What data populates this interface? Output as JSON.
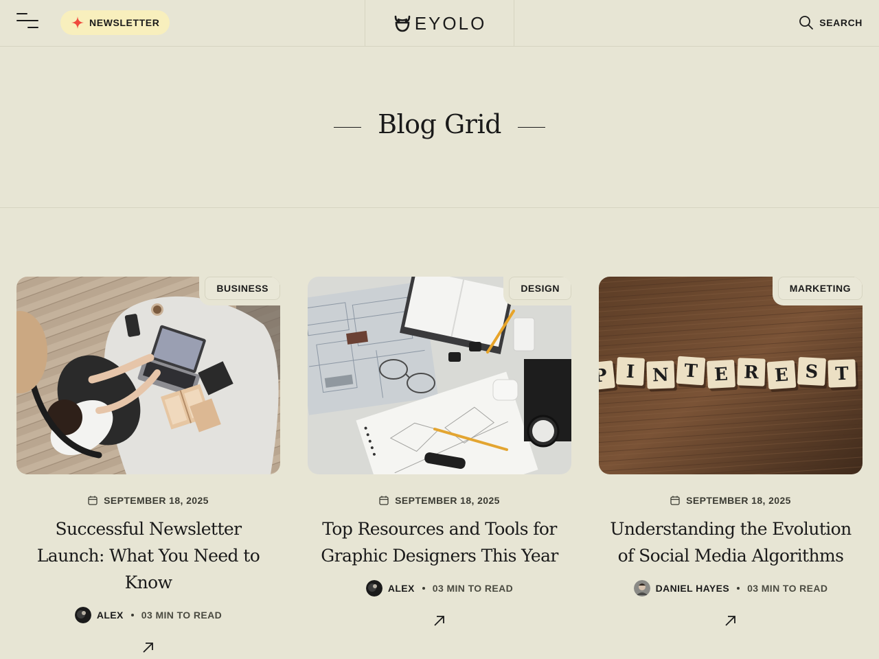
{
  "header": {
    "newsletter_label": "NEWSLETTER",
    "logo_text": "EYOLO",
    "search_label": "SEARCH",
    "accent_color": "#ef4a3e",
    "newsletter_bg": "#f8efbd"
  },
  "hero": {
    "title": "Blog Grid"
  },
  "posts": [
    {
      "category": "BUSINESS",
      "date": "SEPTEMBER 18, 2025",
      "title": "Successful Newsletter Launch: What You Need to Know",
      "author": "ALEX",
      "read_time": "03 MIN TO READ",
      "image": "woman-working-on-laptop-photo"
    },
    {
      "category": "DESIGN",
      "date": "SEPTEMBER 18, 2025",
      "title": "Top Resources and Tools for Graphic Designers This Year",
      "author": "ALEX",
      "read_time": "03 MIN TO READ",
      "image": "designer-desk-sketches-photo"
    },
    {
      "category": "MARKETING",
      "date": "SEPTEMBER 18, 2025",
      "title": "Understanding the Evolution of Social Media Algorithms",
      "author": "DANIEL HAYES",
      "read_time": "03 MIN TO READ",
      "image": "pinterest-letter-tiles-photo",
      "tiles": [
        "P",
        "I",
        "N",
        "T",
        "E",
        "R",
        "E",
        "S",
        "T"
      ]
    }
  ]
}
